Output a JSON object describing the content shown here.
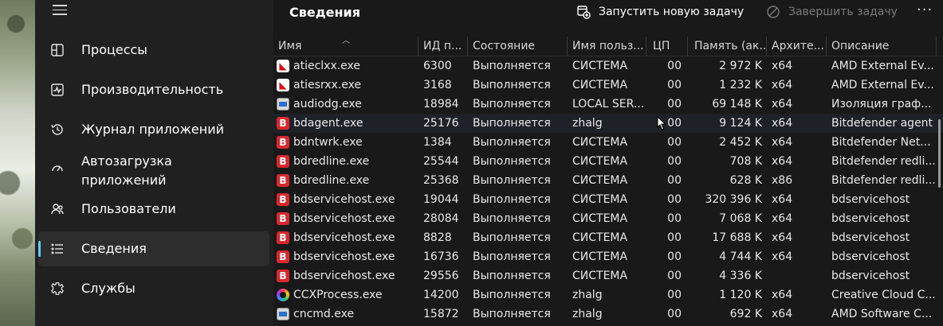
{
  "sidebar": {
    "items": [
      {
        "label": "Процессы",
        "icon": "processes-icon"
      },
      {
        "label": "Производительность",
        "icon": "performance-icon"
      },
      {
        "label": "Журнал приложений",
        "icon": "app-history-icon"
      },
      {
        "label": "Автозагрузка приложений",
        "icon": "startup-apps-icon"
      },
      {
        "label": "Пользователи",
        "icon": "users-icon"
      },
      {
        "label": "Сведения",
        "icon": "details-icon"
      },
      {
        "label": "Службы",
        "icon": "services-icon"
      }
    ]
  },
  "toolbar": {
    "title": "Сведения",
    "run_task_label": "Запустить новую задачу",
    "end_task_label": "Завершить задачу",
    "more_label": "···"
  },
  "table": {
    "columns": [
      "Имя",
      "ИД п...",
      "Состояние",
      "Имя польз...",
      "ЦП",
      "Память (ак...",
      "Архите...",
      "Описание"
    ],
    "rows": [
      {
        "icon": "amd",
        "name": "atieclxx.exe",
        "pid": "6300",
        "state": "Выполняется",
        "user": "СИСТЕМА",
        "cpu": "00",
        "mem": "2 972 K",
        "arch": "x64",
        "desc": "AMD External Ev..."
      },
      {
        "icon": "amd",
        "name": "atiesrxx.exe",
        "pid": "3168",
        "state": "Выполняется",
        "user": "СИСТЕМА",
        "cpu": "00",
        "mem": "1 232 K",
        "arch": "x64",
        "desc": "AMD External Ev..."
      },
      {
        "icon": "win",
        "name": "audiodg.exe",
        "pid": "18984",
        "state": "Выполняется",
        "user": "LOCAL SER...",
        "cpu": "00",
        "mem": "69 148 K",
        "arch": "x64",
        "desc": "Изоляция граф..."
      },
      {
        "icon": "bd",
        "name": "bdagent.exe",
        "pid": "25176",
        "state": "Выполняется",
        "user": "zhalg",
        "cpu": "00",
        "mem": "9 124 K",
        "arch": "x64",
        "desc": "Bitdefender agent"
      },
      {
        "icon": "bd",
        "name": "bdntwrk.exe",
        "pid": "1384",
        "state": "Выполняется",
        "user": "СИСТЕМА",
        "cpu": "00",
        "mem": "2 452 K",
        "arch": "x64",
        "desc": "Bitdefender Net..."
      },
      {
        "icon": "bd",
        "name": "bdredline.exe",
        "pid": "25544",
        "state": "Выполняется",
        "user": "СИСТЕМА",
        "cpu": "00",
        "mem": "708 K",
        "arch": "x64",
        "desc": "Bitdefender redli..."
      },
      {
        "icon": "bd",
        "name": "bdredline.exe",
        "pid": "25368",
        "state": "Выполняется",
        "user": "СИСТЕМА",
        "cpu": "00",
        "mem": "628 K",
        "arch": "x86",
        "desc": "Bitdefender redli..."
      },
      {
        "icon": "bd",
        "name": "bdservicehost.exe",
        "pid": "19044",
        "state": "Выполняется",
        "user": "СИСТЕМА",
        "cpu": "00",
        "mem": "320 396 K",
        "arch": "x64",
        "desc": "bdservicehost"
      },
      {
        "icon": "bd",
        "name": "bdservicehost.exe",
        "pid": "28084",
        "state": "Выполняется",
        "user": "СИСТЕМА",
        "cpu": "00",
        "mem": "7 068 K",
        "arch": "x64",
        "desc": "bdservicehost"
      },
      {
        "icon": "bd",
        "name": "bdservicehost.exe",
        "pid": "8828",
        "state": "Выполняется",
        "user": "СИСТЕМА",
        "cpu": "00",
        "mem": "17 688 K",
        "arch": "x64",
        "desc": "bdservicehost"
      },
      {
        "icon": "bd",
        "name": "bdservicehost.exe",
        "pid": "16736",
        "state": "Выполняется",
        "user": "СИСТЕМА",
        "cpu": "00",
        "mem": "4 744 K",
        "arch": "x64",
        "desc": "bdservicehost"
      },
      {
        "icon": "bd",
        "name": "bdservicehost.exe",
        "pid": "29556",
        "state": "Выполняется",
        "user": "СИСТЕМА",
        "cpu": "00",
        "mem": "4 336 K",
        "arch": "",
        "desc": "bdservicehost"
      },
      {
        "icon": "cc",
        "name": "CCXProcess.exe",
        "pid": "14200",
        "state": "Выполняется",
        "user": "zhalg",
        "cpu": "00",
        "mem": "1 120 K",
        "arch": "x64",
        "desc": "Creative Cloud C..."
      },
      {
        "icon": "win",
        "name": "cncmd.exe",
        "pid": "15872",
        "state": "Выполняется",
        "user": "zhalg",
        "cpu": "00",
        "mem": "692 K",
        "arch": "x64",
        "desc": "AMD Software C..."
      }
    ]
  },
  "colors": {
    "accent": "#60cdff",
    "bitdefender": "#d8282f",
    "amd": "#d80f1a"
  }
}
